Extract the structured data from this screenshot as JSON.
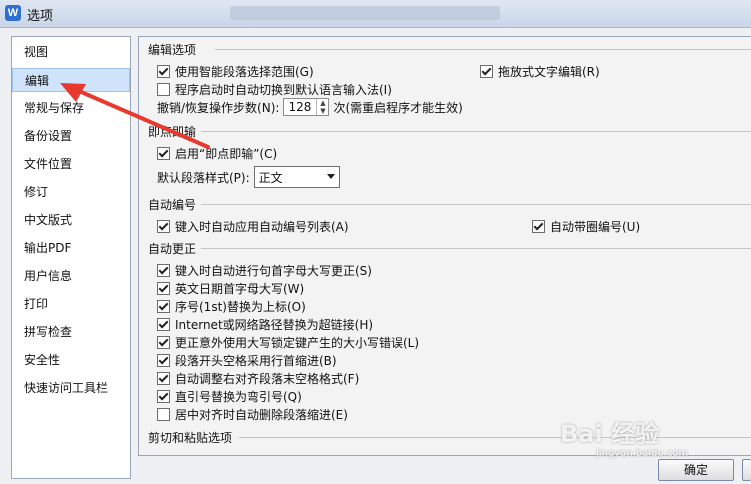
{
  "window": {
    "title": "选项"
  },
  "sidebar": {
    "items": [
      {
        "label": "视图"
      },
      {
        "label": "编辑"
      },
      {
        "label": "常规与保存"
      },
      {
        "label": "备份设置"
      },
      {
        "label": "文件位置"
      },
      {
        "label": "修订"
      },
      {
        "label": "中文版式"
      },
      {
        "label": "输出PDF"
      },
      {
        "label": "用户信息"
      },
      {
        "label": "打印"
      },
      {
        "label": "拼写检查"
      },
      {
        "label": "安全性"
      },
      {
        "label": "快速访问工具栏"
      }
    ],
    "selected_index": 1
  },
  "edit_options": {
    "title": "编辑选项",
    "smart_paragraph": "使用智能段落选择范围(G)",
    "drag_drop": "拖放式文字编辑(R)",
    "auto_ime": "程序启动时自动切换到默认语言输入法(I)",
    "undo_label": "撤销/恢复操作步数(N):",
    "undo_value": "128",
    "undo_suffix": "次(需重启程序才能生效)"
  },
  "instant": {
    "title": "即点即输",
    "enable": "启用“即点即输”(C)",
    "default_style_label": "默认段落样式(P):",
    "default_style_value": "正文"
  },
  "auto_number": {
    "title": "自动编号",
    "apply_list": "键入时自动应用自动编号列表(A)",
    "circled": "自动带圈编号(U)"
  },
  "auto_correct": {
    "title": "自动更正",
    "items": [
      {
        "label": "键入时自动进行句首字母大写更正(S)",
        "checked": true
      },
      {
        "label": "英文日期首字母大写(W)",
        "checked": true
      },
      {
        "label": "序号(1st)替换为上标(O)",
        "checked": true
      },
      {
        "label": "Internet或网络路径替换为超链接(H)",
        "checked": true
      },
      {
        "label": "更正意外使用大写锁定键产生的大小写错误(L)",
        "checked": true
      },
      {
        "label": "段落开头空格采用行首缩进(B)",
        "checked": true
      },
      {
        "label": "自动调整右对齐段落末空格格式(F)",
        "checked": true
      },
      {
        "label": "直引号替换为弯引号(Q)",
        "checked": true
      },
      {
        "label": "居中对齐时自动删除段落缩进(E)",
        "checked": false
      }
    ]
  },
  "cut_paste": {
    "title": "剪切和粘贴选项"
  },
  "buttons": {
    "ok": "确定"
  },
  "watermark": {
    "main": "Bai 经验",
    "sub": "jingyan.baidu.com"
  },
  "colors": {
    "annotation_arrow": "#e8392f",
    "selected_bg": "#cfe3fb"
  }
}
